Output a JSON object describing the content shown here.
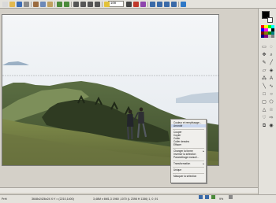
{
  "toolbar": {
    "zoom_value": "100",
    "buttons": [
      {
        "icon": "new-file-icon",
        "color": "#d9d9d9"
      },
      {
        "icon": "open-folder-icon",
        "color": "#e2b950"
      },
      {
        "icon": "save-icon",
        "color": "#3d6db5"
      },
      {
        "icon": "print-icon",
        "color": "#8a8a8a"
      },
      {
        "icon": "cut-icon",
        "color": "#9b6b3e"
      },
      {
        "icon": "copy-icon",
        "color": "#6d89b8"
      },
      {
        "icon": "paste-icon",
        "color": "#c0a060"
      },
      {
        "icon": "undo-icon",
        "color": "#4a8a3a"
      },
      {
        "icon": "redo-icon",
        "color": "#4a8a3a"
      },
      {
        "icon": "crop-icon",
        "color": "#555555"
      },
      {
        "icon": "resize-icon",
        "color": "#555555"
      },
      {
        "icon": "rotate-icon",
        "color": "#555555"
      },
      {
        "icon": "flip-icon",
        "color": "#555555"
      },
      {
        "icon": "brightness-icon",
        "color": "#e3c23a"
      },
      {
        "icon": "contrast-icon",
        "color": "#444444"
      },
      {
        "icon": "color-adjust-icon",
        "color": "#c0392b"
      },
      {
        "icon": "effects-icon",
        "color": "#8e44ad"
      },
      {
        "icon": "zoom-out-icon",
        "color": "#3a6aa8"
      },
      {
        "icon": "zoom-in-icon",
        "color": "#3a6aa8"
      },
      {
        "icon": "fit-window-icon",
        "color": "#3a6aa8"
      },
      {
        "icon": "actual-size-icon",
        "color": "#3a6aa8"
      },
      {
        "icon": "help-icon",
        "color": "#2e78c7"
      }
    ]
  },
  "context_menu": {
    "items": [
      {
        "label": "Couleur et remplissage...",
        "type": "item"
      },
      {
        "label": "Arrondir",
        "type": "item",
        "highlighted": true
      },
      {
        "type": "separator"
      },
      {
        "label": "Couper",
        "type": "item"
      },
      {
        "label": "Copier",
        "type": "item"
      },
      {
        "label": "Coller",
        "type": "item"
      },
      {
        "label": "Coller dessins",
        "type": "item"
      },
      {
        "label": "Effacer",
        "type": "item"
      },
      {
        "type": "separator"
      },
      {
        "label": "Changer la forme",
        "type": "item",
        "submenu": true
      },
      {
        "label": "Inverser la sélection",
        "type": "item"
      },
      {
        "label": "Paramétrage manuel...",
        "type": "item"
      },
      {
        "type": "separator"
      },
      {
        "label": "Transformation",
        "type": "item",
        "submenu": true
      },
      {
        "type": "separator"
      },
      {
        "label": "Unique",
        "type": "item"
      },
      {
        "type": "separator"
      },
      {
        "label": "Masquer la sélection",
        "type": "item"
      }
    ]
  },
  "status": {
    "left": "Prêt",
    "image_info": "3648x2426x24   X:Y = (2210,1400)",
    "selection_info": "3,48M x 6M1,3 1960 ,1070 (L 2398 H 1156) 1,  0 ,91",
    "zoom": "9%"
  },
  "palette_colors": [
    "#ff0000",
    "#ffff00",
    "#00ff00",
    "#00ffff",
    "#0000ff",
    "#ff00ff",
    "#ffffff",
    "#000000",
    "#800000",
    "#808000",
    "#008000",
    "#008080",
    "#000080",
    "#800080",
    "#c0c0c0",
    "#808080"
  ],
  "tools": [
    {
      "icon": "select-rect-icon",
      "glyph": "▭"
    },
    {
      "icon": "select-lasso-icon",
      "glyph": "◌"
    },
    {
      "icon": "move-icon",
      "glyph": "✥"
    },
    {
      "icon": "zoom-tool-icon",
      "glyph": "⌕"
    },
    {
      "icon": "pencil-icon",
      "glyph": "✎"
    },
    {
      "icon": "brush-icon",
      "glyph": "╱"
    },
    {
      "icon": "eraser-icon",
      "glyph": "▱"
    },
    {
      "icon": "fill-icon",
      "glyph": "◈"
    },
    {
      "icon": "dropper-icon",
      "glyph": "⁂"
    },
    {
      "icon": "text-tool-icon",
      "glyph": "A"
    },
    {
      "icon": "line-icon",
      "glyph": "╲"
    },
    {
      "icon": "curve-icon",
      "glyph": "∿"
    },
    {
      "icon": "rectangle-icon",
      "glyph": "□"
    },
    {
      "icon": "ellipse-icon",
      "glyph": "○"
    },
    {
      "icon": "rounded-rect-icon",
      "glyph": "▢"
    },
    {
      "icon": "polygon-icon",
      "glyph": "⬠"
    },
    {
      "icon": "triangle-icon",
      "glyph": "△"
    },
    {
      "icon": "star-icon",
      "glyph": "☆"
    },
    {
      "icon": "heart-icon",
      "glyph": "♡"
    },
    {
      "icon": "arrow-shape-icon",
      "glyph": "⇨"
    },
    {
      "icon": "clone-icon",
      "glyph": "⧉"
    },
    {
      "icon": "redeye-icon",
      "glyph": "◉"
    }
  ]
}
